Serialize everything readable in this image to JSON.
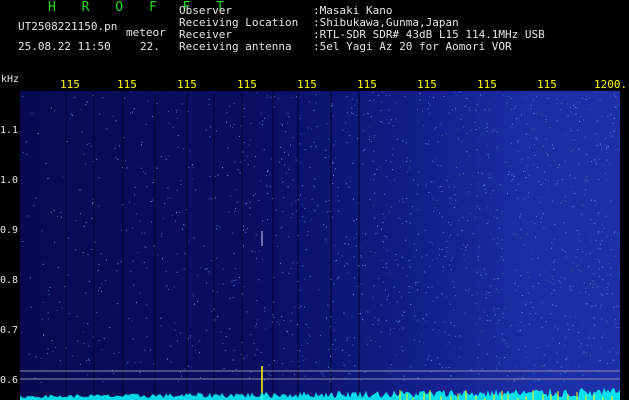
{
  "header": {
    "brand": "H R O F F T",
    "filename": "UT2508221150.pn",
    "meteor_label": "meteor",
    "datetime": "25.08.22 11:50",
    "count": "22.",
    "fields": [
      {
        "key": "Observer",
        "value": ":Masaki Kano"
      },
      {
        "key": "Receiving Location",
        "value": ":Shibukawa,Gunma,Japan"
      },
      {
        "key": "Receiver",
        "value": ":RTL-SDR SDR# 43dB L15 114.1MHz USB"
      },
      {
        "key": "Receiving antenna",
        "value": ":5el Yagi Az 20 for Aomori VOR"
      }
    ]
  },
  "axis": {
    "unit": "kHz",
    "x_ticks": [
      "115",
      "115",
      "115",
      "115",
      "115",
      "115",
      "115",
      "115",
      "115",
      "1200."
    ],
    "y_ticks": [
      "1.1",
      "1.0",
      "0.9",
      "0.8",
      "0.7",
      "0.6"
    ]
  },
  "colors": {
    "bg": "#000000",
    "signal": "#ffff00",
    "baseline": "#00ffff",
    "brand": "#22dd22"
  }
}
